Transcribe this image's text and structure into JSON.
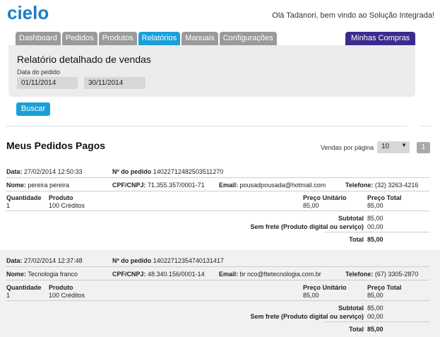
{
  "header": {
    "logo": "cielo",
    "welcome": "Olá Tadanori, bem vindo ao Solução Integrada!"
  },
  "tabs": [
    {
      "label": "Dashboard"
    },
    {
      "label": "Pedidos"
    },
    {
      "label": "Produtos"
    },
    {
      "label": "Relatórios",
      "active": true
    },
    {
      "label": "Manuais"
    },
    {
      "label": "Configurações"
    }
  ],
  "tab_right": "Minhas Compras",
  "panel": {
    "title": "Relatório detalhado de vendas",
    "date_label": "Data do pedido",
    "date_from": "01/11/2014",
    "date_to": "30/11/2014",
    "search_button": "Buscar"
  },
  "section": {
    "title": "Meus Pedidos Pagos",
    "per_page_label": "Vendas por página",
    "per_page_value": "10",
    "page": "1"
  },
  "labels": {
    "data": "Data:",
    "pedido": "Nº do pedido",
    "nome": "Nome:",
    "cpf": "CPF/CNPJ:",
    "email": "Email:",
    "telefone": "Telefone:",
    "quantidade": "Quantidade",
    "produto": "Produto",
    "preco_unitario": "Preço Unitário",
    "preco_total": "Preço Total",
    "subtotal": "Subtotal",
    "frete": "Sem frete (Produto digital ou serviço)",
    "total": "Total"
  },
  "orders": [
    {
      "data": "27/02/2014 12:50:33",
      "pedido": "14022712482503511270",
      "nome": "pereira pereira",
      "cpf": "71.355.357/0001-71",
      "email": "pousadpousada@hotmail.com",
      "telefone": "(32) 3263-4216",
      "quantidade": "1",
      "produto": "100 Créditos",
      "preco_unitario": "85,00",
      "preco_total": "85,00",
      "subtotal": "85,00",
      "frete": "00,00",
      "total": "85,00"
    },
    {
      "data": "27/02/2014 12:37:48",
      "pedido": "14022712354740131417",
      "nome": "Tecnologia franco",
      "cpf": "48.340.156/0001-14",
      "email": "br nco@ftetecnologia.com.br",
      "telefone": "(67) 3305-2870",
      "quantidade": "1",
      "produto": "100 Créditos",
      "preco_unitario": "85,00",
      "preco_total": "85,00",
      "subtotal": "85,00",
      "frete": "00,00",
      "total": "85,00"
    }
  ]
}
